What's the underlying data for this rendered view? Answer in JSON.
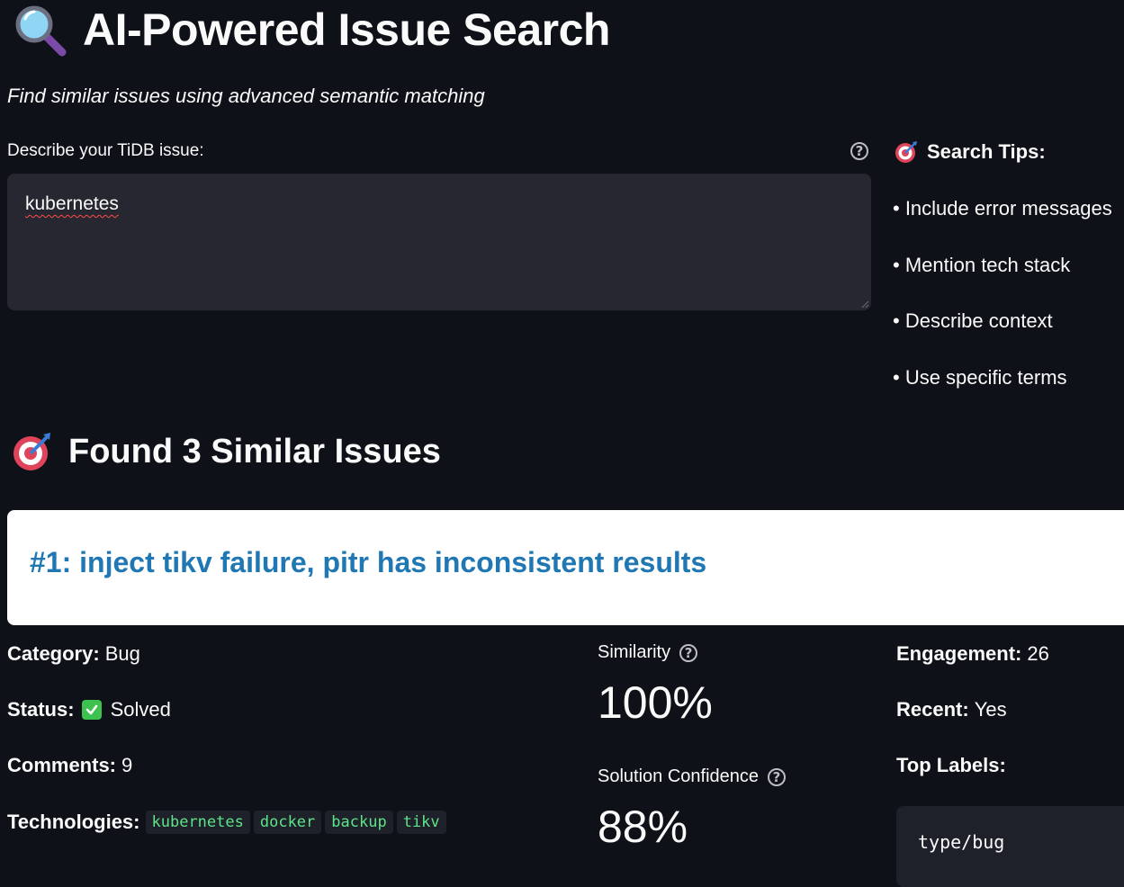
{
  "header": {
    "title_icon": "magnifying-glass-icon",
    "title": "AI-Powered Issue Search",
    "subtitle": "Find similar issues using advanced semantic matching"
  },
  "search": {
    "label": "Describe your TiDB issue:",
    "value": "kubernetes",
    "help_icon": "question-circle-icon"
  },
  "tips": {
    "icon": "target-icon",
    "title": "Search Tips:",
    "items": [
      "• Include error messages",
      "• Mention tech stack",
      "• Describe context",
      "• Use specific terms"
    ]
  },
  "results": {
    "icon": "target-icon",
    "heading": "Found 3 Similar Issues",
    "issues": [
      {
        "title": "#1: inject tikv failure, pitr has inconsistent results",
        "category_label": "Category:",
        "category": "Bug",
        "status_label": "Status:",
        "status_icon": "check-mark-icon",
        "status": "Solved",
        "comments_label": "Comments:",
        "comments": "9",
        "technologies_label": "Technologies:",
        "technologies": [
          "kubernetes",
          "docker",
          "backup",
          "tikv"
        ],
        "similarity_label": "Similarity",
        "similarity": "100%",
        "confidence_label": "Solution Confidence",
        "confidence": "88%",
        "engagement_label": "Engagement:",
        "engagement": "26",
        "recent_label": "Recent:",
        "recent": "Yes",
        "top_labels_label": "Top Labels:",
        "top_labels": [
          "type/bug"
        ]
      }
    ]
  },
  "colors": {
    "background": "#0e1117",
    "input_bg": "#262730",
    "link_blue": "#1f77b4",
    "tag_green": "#5ce488",
    "check_green": "#3ec24f"
  }
}
